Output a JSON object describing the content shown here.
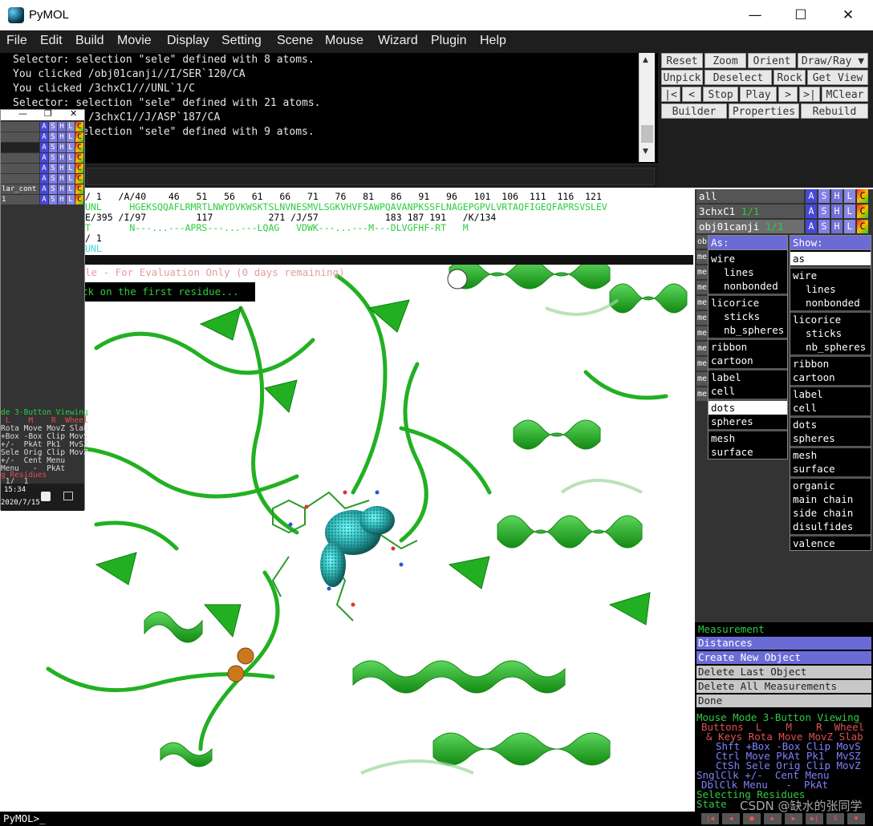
{
  "window": {
    "title": "PyMOL",
    "minimize": "—",
    "maximize": "☐",
    "close": "✕"
  },
  "menu": [
    "File",
    "Edit",
    "Build",
    "Movie",
    "Display",
    "Setting",
    "Scene",
    "Mouse",
    "Wizard",
    "Plugin",
    "Help"
  ],
  "console": {
    "lines": [
      "Selector: selection \"sele\" defined with 8 atoms.",
      "You clicked /obj01canji//I/SER`120/CA",
      "You clicked /3chxC1///UNL`1/C",
      "Selector: selection \"sele\" defined with 21 atoms.",
      "You clicked /3chxC1//J/ASP`187/CA",
      "Selector: selection \"sele\" defined with 9 atoms."
    ]
  },
  "toolbar": {
    "reset": "Reset",
    "zoom": "Zoom",
    "orient": "Orient",
    "drawray": "Draw/Ray ▼",
    "unpick": "Unpick",
    "deselect": "Deselect",
    "rock": "Rock",
    "getview": "Get View",
    "first": "|<",
    "prev": "<",
    "stop": "Stop",
    "play": "Play",
    "next": ">",
    "last": ">|",
    "mclear": "MClear",
    "builder": "Builder",
    "properties": "Properties",
    "rebuild": "Rebuild"
  },
  "sequence": {
    "line1": "/ 1   /A/40    46   51   56   61   66   71   76   81   86   91   96   101  106  111  116  121",
    "line2": "UNL     HGEKSQQAFLRMRTLNWYDVKWSKTSLNVNESMVLSGKVHVFSAWPQAVANPKSSFLNAGEPGPVLVRTAQFIGEQFAPRSVSLEV",
    "line3": "E/395 /I/97         117          271 /J/57            183 187 191   /K/134",
    "line4": "T       N---...---APRS---...---LQAG   VDWK---...---M---DLVGFHF-RT   M",
    "line5": "/ 1",
    "line6": "UNL"
  },
  "viewer": {
    "eval_notice": "le - For Evaluation Only (0 days remaining)",
    "click_prompt": "ck on the first residue..."
  },
  "objects": [
    {
      "name": "all",
      "state": ""
    },
    {
      "name": "3chxC1",
      "state": "1/1"
    },
    {
      "name": "obj01canji",
      "state": "1/1"
    }
  ],
  "ashlc": [
    "A",
    "S",
    "H",
    "L",
    "C"
  ],
  "hidden_rows": [
    "ob",
    "me",
    "me",
    "me",
    "me",
    "me",
    "me",
    "me",
    "me",
    "me",
    "me"
  ],
  "as_menu": {
    "title": "As:",
    "items": [
      "wire",
      "lines",
      "nonbonded",
      "licorice",
      "sticks",
      "nb_spheres",
      "ribbon",
      "cartoon",
      "label",
      "cell",
      "dots",
      "spheres",
      "mesh",
      "surface"
    ]
  },
  "show_menu": {
    "title": "Show:",
    "items": [
      "as",
      "wire",
      "lines",
      "nonbonded",
      "licorice",
      "sticks",
      "nb_spheres",
      "ribbon",
      "cartoon",
      "label",
      "cell",
      "dots",
      "spheres",
      "mesh",
      "surface",
      "organic",
      "main chain",
      "side chain",
      "disulfides",
      "valence"
    ]
  },
  "wizard": {
    "title": "Measurement",
    "mode": "Distances",
    "create": "Create New Object",
    "delete_last": "Delete Last Object",
    "delete_all": "Delete All Measurements",
    "done": "Done"
  },
  "mouse_mode": {
    "title": "Mouse Mode 3-Button Viewing",
    "buttons": "Buttons  L    M    R  Wheel",
    "keys": "& Keys Rota Move MovZ Slab",
    "shft": "Shft +Box -Box Clip MovS",
    "ctrl": "Ctrl Move PkAt Pk1  MvSZ",
    "ctsh": "CtSh Sele Orig Clip MovZ",
    "sngl": "SnglClk +/-  Cent Menu",
    "dbl": "DblClk Menu   -  PkAt",
    "selecting": "Selecting Residues",
    "state": "State"
  },
  "subwindow": {
    "rows": [
      "",
      "",
      "",
      "",
      "",
      "",
      "lar_cont",
      "1"
    ],
    "mm_title": "de 3-Button Viewing",
    "mm_lines": [
      " L    M    R  Wheel",
      "Rota Move MovZ Slab",
      "+Box -Box Clip MovS",
      "+/-  PkAt Pk1  MvSZ",
      "Sele Orig Clip MovZ",
      "+/-  Cent Menu",
      "Menu   -  PkAt",
      "g Residues",
      " 1/  1"
    ],
    "time": "15:34",
    "date": "2020/7/15"
  },
  "prompt": "PyMOL>_",
  "watermark": "CSDN @缺水的张同学",
  "colors": {
    "cartoon": "#22b022",
    "accent": "#6b6bd6",
    "green_text": "#2ecc40"
  }
}
